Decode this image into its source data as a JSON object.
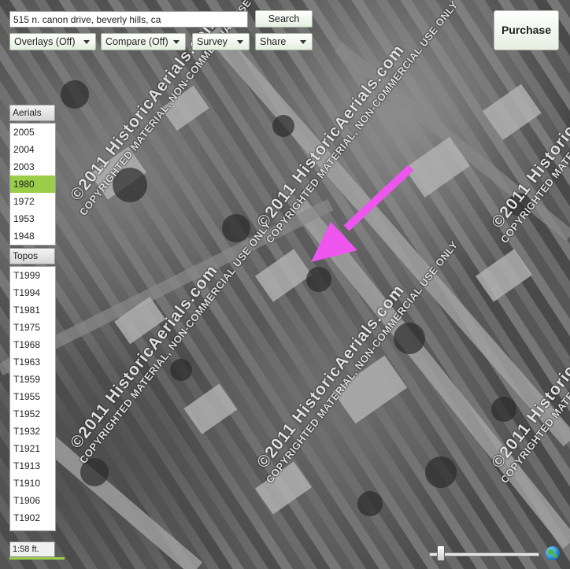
{
  "search": {
    "value": "515 n. canon drive, beverly hills, ca",
    "button_label": "Search"
  },
  "toolbar": {
    "overlays_label": "Overlays (Off)",
    "compare_label": "Compare (Off)",
    "survey_label": "Survey",
    "share_label": "Share"
  },
  "purchase_label": "Purchase",
  "aerials": {
    "header": "Aerials",
    "selected": "1980",
    "years": [
      "2005",
      "2004",
      "2003",
      "1980",
      "1972",
      "1953",
      "1948"
    ]
  },
  "topos": {
    "header": "Topos",
    "years": [
      "T1999",
      "T1994",
      "T1981",
      "T1975",
      "T1968",
      "T1963",
      "T1959",
      "T1955",
      "T1952",
      "T1932",
      "T1921",
      "T1913",
      "T1910",
      "T1906",
      "T1902"
    ]
  },
  "scale_label": "1:58 ft.",
  "watermark": {
    "main": "©2011 HistoricAerials.com",
    "sub": "COPYRIGHTED MATERIAL, NON-COMMERCIAL USE ONLY"
  },
  "colors": {
    "arrow": "#ee55ee",
    "selected_year": "#9acd4a"
  },
  "zoom_slider_level": 0.08
}
